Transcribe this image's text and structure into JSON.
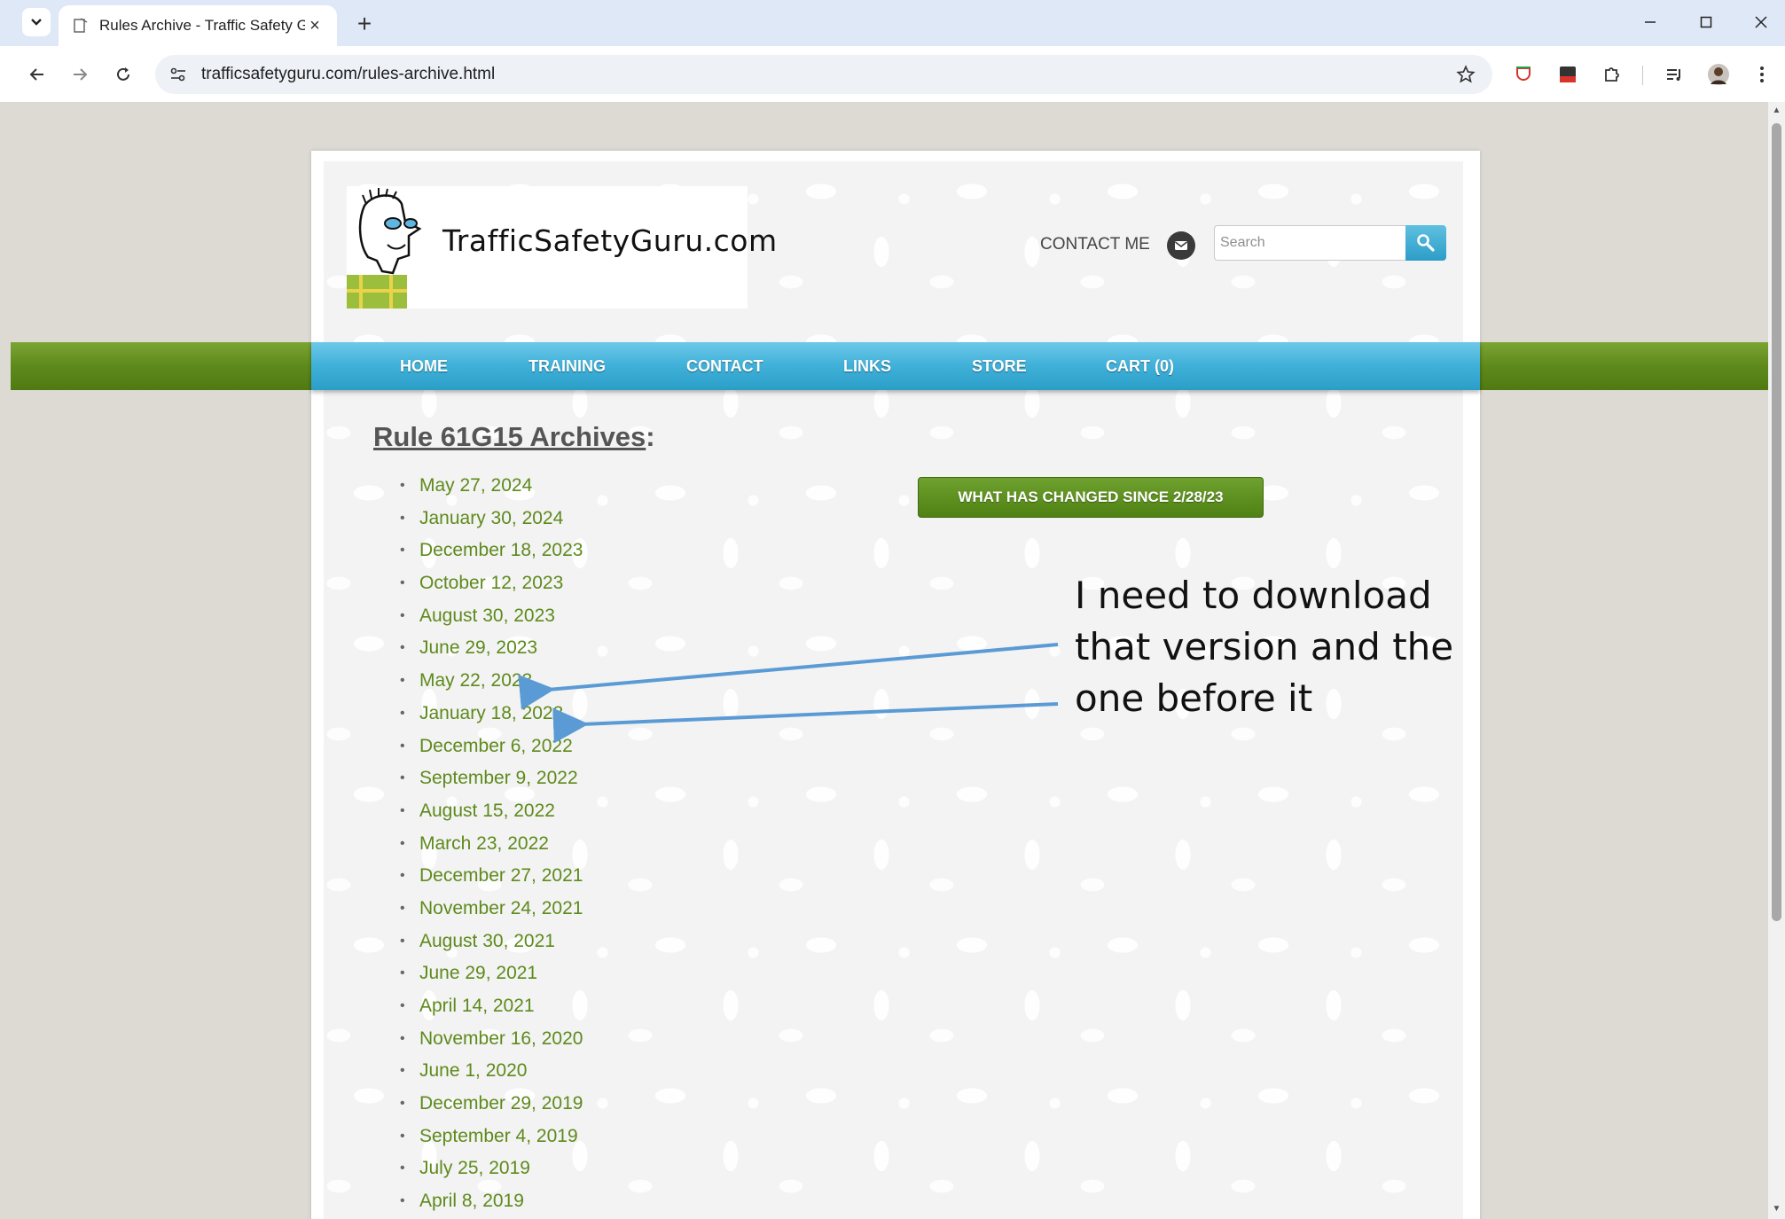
{
  "browser": {
    "tab_title": "Rules Archive - Traffic Safety Gu",
    "url": "trafficsafetyguru.com/rules-archive.html",
    "new_tab_label": "+",
    "close_label": "×"
  },
  "site": {
    "logo_text": "TrafficSafetyGuru.com",
    "contact_me": "CONTACT ME",
    "search_placeholder": "Search",
    "nav": [
      "HOME",
      "TRAINING",
      "CONTACT",
      "LINKS",
      "STORE",
      "CART (0)"
    ]
  },
  "archives": {
    "title": "Rule 61G15 Archives",
    "title_suffix": ":",
    "dates": [
      "May 27, 2024",
      "January 30, 2024",
      "December 18, 2023",
      "October 12, 2023",
      "August 30, 2023",
      "June 29, 2023",
      "May 22, 2023",
      "January 18, 2023",
      "December 6, 2022",
      "September 9, 2022",
      "August 15, 2022",
      "March 23, 2022",
      "December 27, 2021",
      "November 24, 2021",
      "August 30, 2021",
      "June 29, 2021",
      "April 14, 2021",
      "November 16, 2020",
      "June 1, 2020",
      "December 29, 2019",
      "September 4, 2019",
      "July 25, 2019",
      "April 8, 2019"
    ],
    "changes_button": "WHAT HAS CHANGED SINCE 2/28/23"
  },
  "annotation": {
    "lines": [
      "I need to download",
      "that version and the",
      "one before it"
    ]
  },
  "colors": {
    "link_green": "#5e8a1c",
    "nav_blue": "#3fb0d8",
    "band_green": "#5e8a1c",
    "arrow_blue": "#5b9bd5"
  }
}
